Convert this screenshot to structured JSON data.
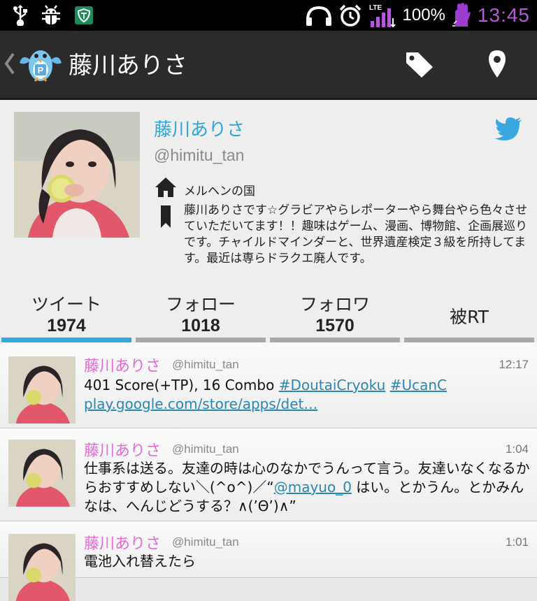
{
  "status_bar": {
    "battery": "100%",
    "time": "13:45",
    "network": "LTE",
    "icons_left": [
      "usb-icon",
      "bug-icon",
      "app-shield-icon"
    ],
    "icons_right": [
      "headphones-icon",
      "alarm-icon",
      "lte-signal-icon",
      "battery-glove-icon"
    ]
  },
  "action_bar": {
    "title": "藤川ありさ",
    "icons": [
      "back-chevron-icon",
      "app-logo-icon",
      "tag-icon",
      "location-pin-icon"
    ]
  },
  "profile": {
    "name": "藤川ありさ",
    "handle": "@himitu_tan",
    "location": "メルヘンの国",
    "bio": "藤川ありさです☆グラビアやらレポーターやら舞台やら色々させていただいてます！！趣味はゲーム、漫画、博物館、企画展巡りです。チャイルドマインダーと、世界遺産検定３級を所持してます。最近は専らドラクエ廃人です。"
  },
  "tabs": [
    {
      "label": "ツイート",
      "count": "1974"
    },
    {
      "label": "フォロー",
      "count": "1018"
    },
    {
      "label": "フォロワ",
      "count": "1570"
    },
    {
      "label": "被RT"
    }
  ],
  "colors": {
    "accent": "#33a9df",
    "name_pink": "#e36ad7",
    "link": "#2a87b3",
    "clock": "#b35bd6"
  },
  "tweets": [
    {
      "name": "藤川ありさ",
      "handle": "@himitu_tan",
      "time": "12:17",
      "text_prefix": "401 Score(+TP), 16 Combo ",
      "tag1": "#DoutaiCryoku",
      "tag2": "#UcanC",
      "link": "play.google.com/store/apps/det…"
    },
    {
      "name": "藤川ありさ",
      "handle": "@himitu_tan",
      "time": "1:04",
      "text_prefix": "仕事系は送る。友達の時は心のなかでうんって言う。友達いなくなるからおすすめしない＼(^o^)／“",
      "mention": "@mayuo_0",
      "text_suffix": " はい。とかうん。とかみんなは、へんじどうする？∧(’Θ’)∧”"
    },
    {
      "name": "藤川ありさ",
      "handle": "@himitu_tan",
      "time": "1:01",
      "text": "電池入れ替えたら"
    }
  ]
}
